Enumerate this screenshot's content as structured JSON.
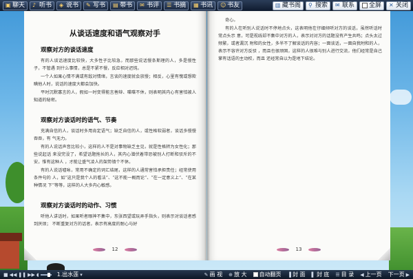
{
  "topbar": {
    "left_buttons": [
      {
        "label": "聊天",
        "icon": "chat-icon"
      },
      {
        "label": "听书",
        "icon": "headphones-icon"
      },
      {
        "label": "说书",
        "icon": "speaker-icon"
      },
      {
        "label": "写书",
        "icon": "pen-icon"
      },
      {
        "label": "带书",
        "icon": "bag-icon"
      },
      {
        "label": "书评",
        "icon": "comment-icon"
      },
      {
        "label": "书摘",
        "icon": "note-icon"
      },
      {
        "label": "书讯",
        "icon": "news-icon"
      },
      {
        "label": "书友",
        "icon": "friends-icon"
      }
    ],
    "right_buttons": [
      {
        "label": "藏书阁",
        "icon": "library-icon"
      },
      {
        "label": "搜索",
        "icon": "search-icon"
      },
      {
        "label": "联系",
        "icon": "mail-icon"
      },
      {
        "label": "全屏",
        "icon": "checkbox"
      },
      {
        "label": "关闭",
        "icon": "close-icon"
      }
    ]
  },
  "left_page": {
    "title": "从谈话速度和语气观察对手",
    "sections": [
      {
        "heading": "观察对方的谈话速度",
        "paragraphs": [
          "有的人谈话速度比较快，大多性子比较急，而那些说话慢条斯理的人，多是慢性子，不管遇 到什么事情，总是不紧不慢，反应相对迟钝。",
          "一个人如果心情不满或有敌对情绪，言谈的速度就会放慢；相反，心里有愧或想欺瞒他人时，说话的速度大都会加快。",
          "平时沉默寡言的人，假如一时变得能言善辩、喋喋不休，则表明其内心有害怕被人知道的秘密。"
        ]
      },
      {
        "heading": "观察对方谈话时的语气、节奏",
        "paragraphs": [
          "充满自信的人，谈话时多用肯定语气；缺乏自信的人，或性格软弱者，谈话多慢慢吞吞，有 气无力。",
          "有的人说话声音比较小，这样的人不是对事物缺乏主见，就是性格转为女性化；那些说起话 来没完没了，希望话题拖长的人，其内心潜伏着带恐被别人打断和驳斥的不安，惟有这种人 ，才能让盛气凌人的架势镇个不休。",
          "有的人说话嘘咏，常用不确定的词汇结尾，这样的人通常害怕承担责任；经常使用条件句的 人，如“这只是我个人的看法”、“这不能一概而论”、“在一定意义上”、“在某种情况 下”等等，这样的人大多内心敏感。"
        ]
      },
      {
        "heading": "观察对方谈话时的动作、习惯",
        "paragraphs": [
          "听他人讲话时，如果听者眼神不集中，东张西望或玩弄手指头，则表示对谈话者感到厌烦； 不断重复对方的话者，表示有高度的耐心与好"
        ]
      }
    ],
    "page_number": "12"
  },
  "right_page": {
    "paragraphs": [
      "奇心。",
      "有的人在听别人说话时不停地点头，这表明他在仔细倾听对方的谈话，虽然听话时常点头示 意，可是视线却不集中对方的人，表示对对方的话题没有产生共鸣；点头太过频繁，或者漏沉 附和的女性，多半不了解谈话的内容；一面谈话，一面自我附和的人，表示不容许对方反驳 ，而且也很顽固，这样的人很难与别人进行交流，他们经常是自己掌有话语的主动权，而且 还经常自以为是地下结论。"
    ],
    "page_number": "13"
  },
  "bottombar": {
    "play_label": "1.出水莲",
    "items": [
      {
        "label": "画 视",
        "icon": "pen-icon"
      },
      {
        "label": "放 大",
        "icon": "zoom-icon"
      },
      {
        "label": "自动翻页",
        "icon": "checkbox"
      },
      {
        "label": "封 面",
        "icon": "cover-icon"
      },
      {
        "label": "封 底",
        "icon": "back-cover-icon"
      },
      {
        "label": "目 录",
        "icon": "toc-icon"
      },
      {
        "label": "上一页",
        "icon": "prev-icon"
      },
      {
        "label": "下一页",
        "icon": "next-icon"
      }
    ]
  }
}
